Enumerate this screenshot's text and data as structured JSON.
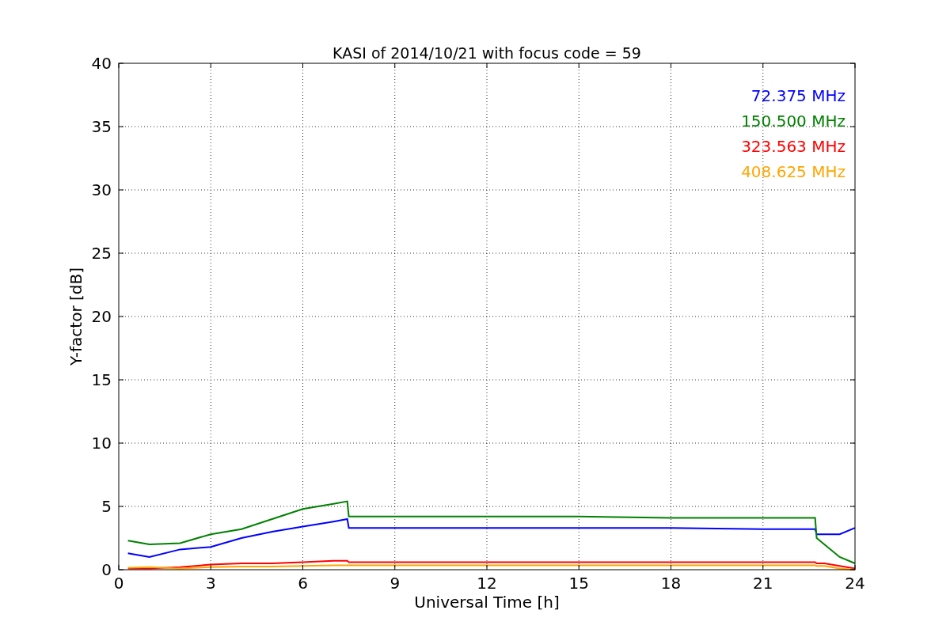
{
  "chart": {
    "chart_data": {
      "type": "line",
      "title": "KASI of 2014/10/21 with focus code = 59",
      "xlabel": "Universal Time [h]",
      "ylabel": "Y-factor [dB]",
      "x": [
        0.3,
        1,
        2,
        3,
        4,
        5,
        6,
        7,
        7.45,
        7.5,
        9,
        12,
        15,
        18,
        21,
        22.7,
        22.75,
        23,
        23.5,
        24
      ],
      "series": [
        {
          "name": "72.375 MHz",
          "color": "#0000ff",
          "values": [
            1.3,
            1.0,
            1.6,
            1.8,
            2.5,
            3.0,
            3.4,
            3.8,
            4.0,
            3.3,
            3.3,
            3.3,
            3.3,
            3.3,
            3.2,
            3.2,
            2.8,
            2.8,
            2.8,
            3.3
          ]
        },
        {
          "name": "150.500 MHz",
          "color": "#008000",
          "values": [
            2.3,
            2.0,
            2.1,
            2.8,
            3.2,
            4.0,
            4.8,
            5.2,
            5.4,
            4.2,
            4.2,
            4.2,
            4.2,
            4.1,
            4.1,
            4.1,
            2.5,
            2.0,
            1.0,
            0.5
          ]
        },
        {
          "name": "323.563 MHz",
          "color": "#ff0000",
          "values": [
            0.1,
            0.1,
            0.2,
            0.4,
            0.5,
            0.5,
            0.6,
            0.7,
            0.7,
            0.6,
            0.6,
            0.6,
            0.6,
            0.6,
            0.6,
            0.6,
            0.5,
            0.5,
            0.3,
            0.1
          ]
        },
        {
          "name": "408.625 MHz",
          "color": "#ffa500",
          "values": [
            0.15,
            0.2,
            0.1,
            0.2,
            0.25,
            0.25,
            0.3,
            0.35,
            0.35,
            0.35,
            0.35,
            0.35,
            0.35,
            0.35,
            0.35,
            0.35,
            0.3,
            0.3,
            0.1,
            0.0
          ]
        }
      ],
      "xlim": [
        0,
        24
      ],
      "ylim": [
        0,
        40
      ],
      "xticks": [
        0,
        3,
        6,
        9,
        12,
        15,
        18,
        21,
        24
      ],
      "yticks": [
        0,
        5,
        10,
        15,
        20,
        25,
        30,
        35,
        40
      ],
      "grid": true
    }
  }
}
